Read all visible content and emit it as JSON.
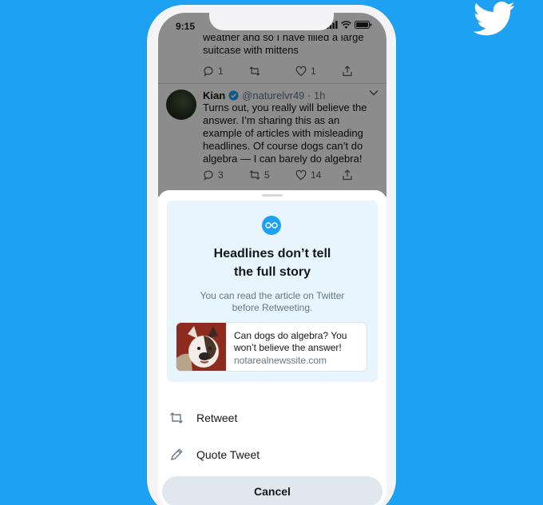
{
  "status_bar": {
    "time": "9:15"
  },
  "previous_tweet": {
    "text_cut": "weather and so I have filled a large",
    "text": "suitcase with mittens",
    "reply_count": "1",
    "like_count": "1"
  },
  "tweet": {
    "name": "Kian",
    "handle": "@naturelvr49 · 1h",
    "text": "Turns out, you really will believe the answer. I’m sharing this as an example of articles with misleading headlines. Of course dogs can’t do algebra — I can barely do algebra!",
    "reply_count": "3",
    "retweet_count": "5",
    "like_count": "14"
  },
  "prompt": {
    "headline_line1": "Headlines don’t tell",
    "headline_line2": "the full story",
    "subtext_line1": "You can read the article on Twitter",
    "subtext_line2": "before Retweeting.",
    "article": {
      "title": "Can dogs do algebra? You won’t believe the answer!",
      "domain": "notarealnewssite.com"
    }
  },
  "menu": {
    "retweet_label": "Retweet",
    "quote_label": "Quote Tweet",
    "cancel_label": "Cancel"
  },
  "colors": {
    "brand": "#1DA1F2",
    "card_bg": "#e8f5fe",
    "muted": "#657786"
  },
  "icons": [
    "twitter-bird-icon",
    "signal-icon",
    "wifi-icon",
    "battery-icon",
    "reply-icon",
    "retweet-icon",
    "like-icon",
    "share-icon",
    "verified-icon",
    "chevron-down-icon",
    "glasses-icon",
    "pencil-icon"
  ]
}
